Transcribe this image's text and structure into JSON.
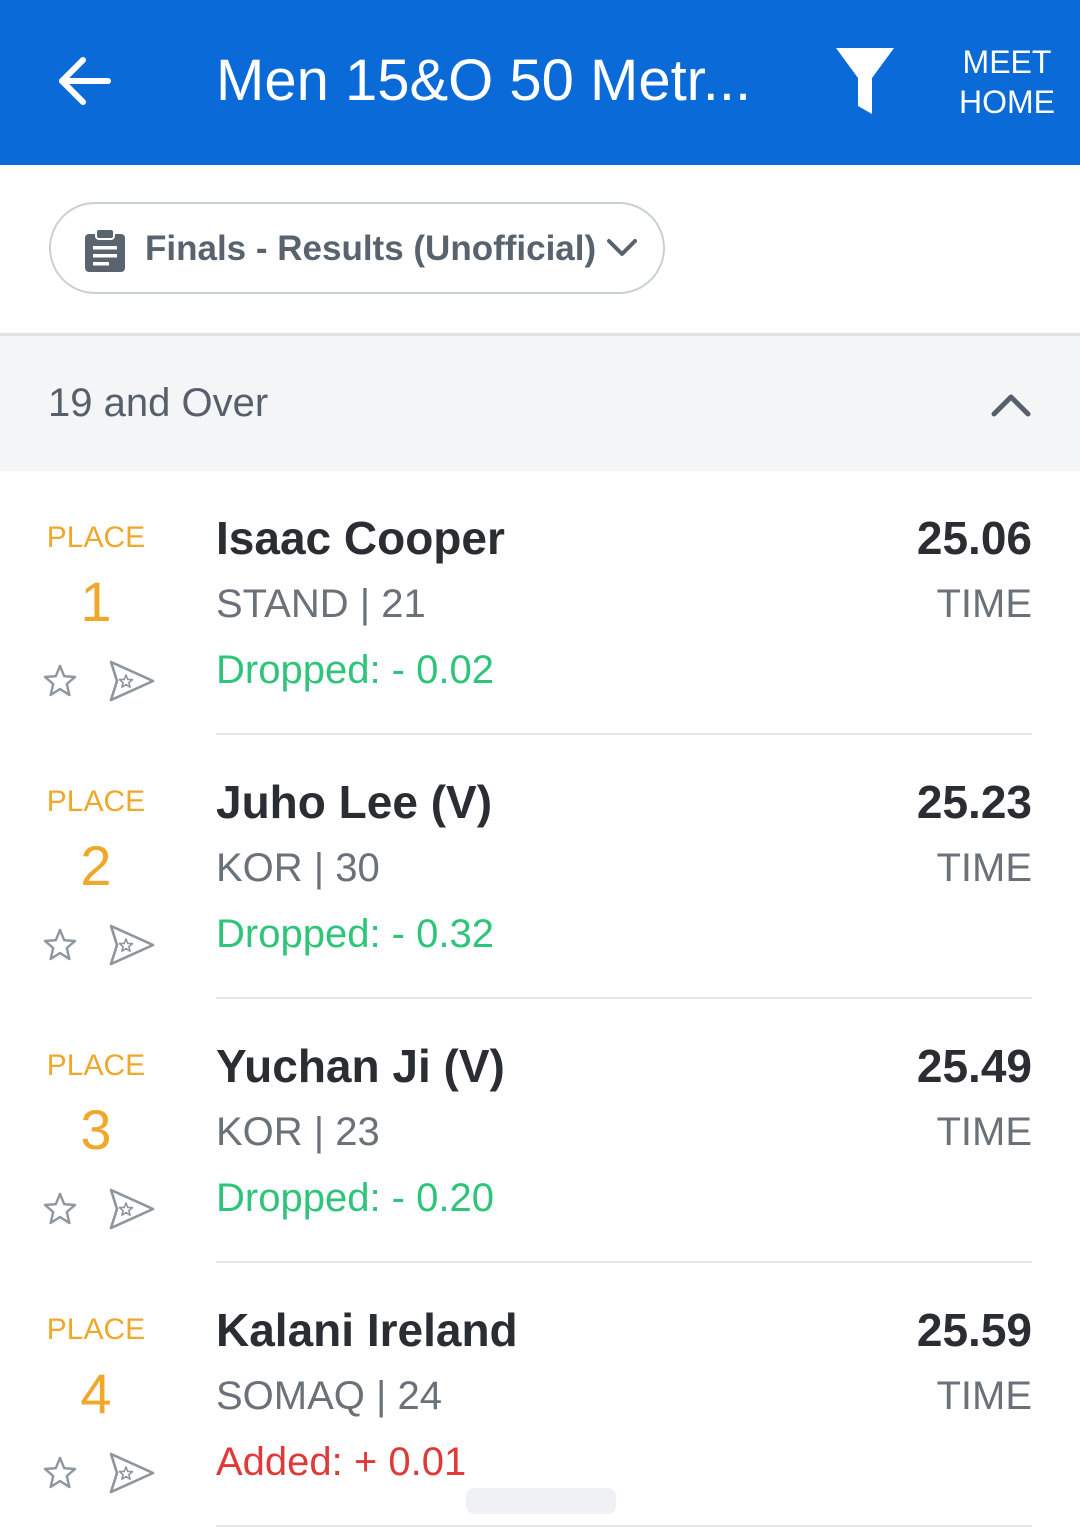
{
  "header": {
    "title": "Men 15&O 50 Metr...",
    "meet_home": [
      "MEET",
      "HOME"
    ],
    "background_color": "#0a6ad8"
  },
  "filter": {
    "label": "Finals - Results (Unofficial)",
    "icon": "clipboard-icon"
  },
  "group": {
    "title": "19 and Over",
    "expanded": true
  },
  "colors": {
    "place": "#f0a82a",
    "dropped": "#2ec47a",
    "added": "#e0393a"
  },
  "results": [
    {
      "place_label": "PLACE",
      "place": "1",
      "name": "Isaac Cooper",
      "team_age": "STAND | 21",
      "delta": "Dropped: - 0.02",
      "delta_type": "dropped",
      "time": "25.06",
      "time_label": "TIME"
    },
    {
      "place_label": "PLACE",
      "place": "2",
      "name": "Juho Lee (V)",
      "team_age": "KOR | 30",
      "delta": "Dropped: - 0.32",
      "delta_type": "dropped",
      "time": "25.23",
      "time_label": "TIME"
    },
    {
      "place_label": "PLACE",
      "place": "3",
      "name": "Yuchan Ji (V)",
      "team_age": "KOR | 23",
      "delta": "Dropped: - 0.20",
      "delta_type": "dropped",
      "time": "25.49",
      "time_label": "TIME"
    },
    {
      "place_label": "PLACE",
      "place": "4",
      "name": "Kalani Ireland",
      "team_age": "SOMAQ | 24",
      "delta": "Added: + 0.01",
      "delta_type": "added",
      "time": "25.59",
      "time_label": "TIME"
    }
  ]
}
